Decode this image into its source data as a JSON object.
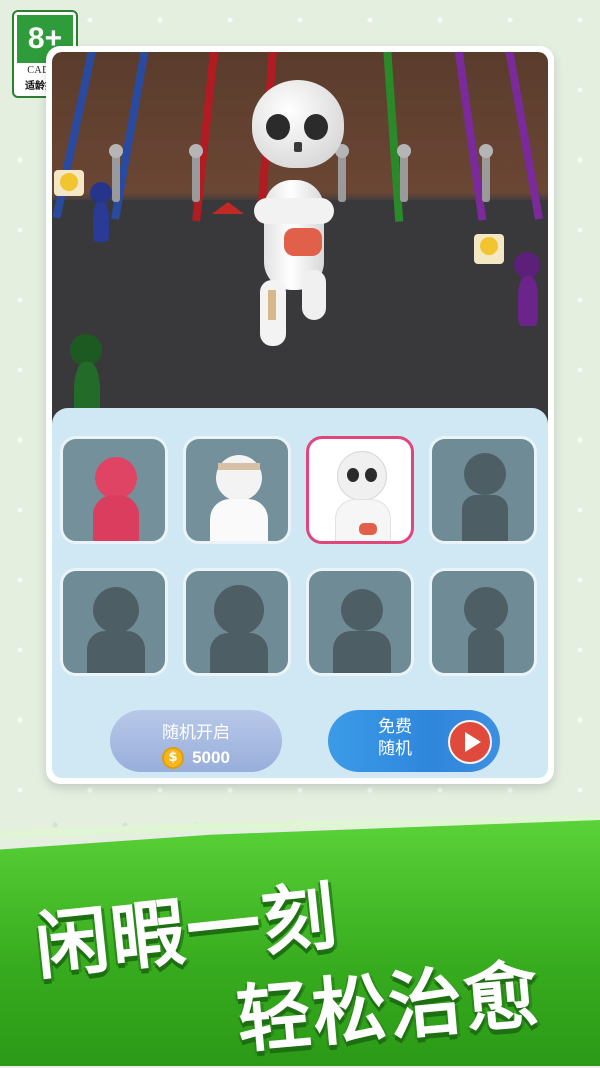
{
  "age_rating": {
    "rating": "8+",
    "org": "CADPA",
    "tip": "适龄提示"
  },
  "character_grid": {
    "rows": 2,
    "columns": 4,
    "slots": [
      {
        "name": "pink-stickman",
        "state": "unlocked"
      },
      {
        "name": "mummy",
        "state": "unlocked"
      },
      {
        "name": "skeleton",
        "state": "selected"
      },
      {
        "name": "locked-robot",
        "state": "locked"
      },
      {
        "name": "locked-spiky-hair",
        "state": "locked"
      },
      {
        "name": "locked-curly-hair",
        "state": "locked"
      },
      {
        "name": "locked-mohawk",
        "state": "locked"
      },
      {
        "name": "locked-bald",
        "state": "locked"
      }
    ]
  },
  "buttons": {
    "random_open": {
      "label": "随机开启",
      "price": "5000",
      "coin_symbol": "$"
    },
    "free_random": {
      "line1": "免费",
      "line2": "随机"
    }
  },
  "slogan": {
    "line1": "闲暇一刻",
    "line2": "轻松治愈"
  },
  "colors": {
    "selected_border": "#e0457c",
    "band_green": "#37ab1e",
    "button_blue": "#2f86dc",
    "button_lavender": "#98aedb",
    "play_red": "#e04a3c",
    "coin_gold": "#f4b81c"
  }
}
